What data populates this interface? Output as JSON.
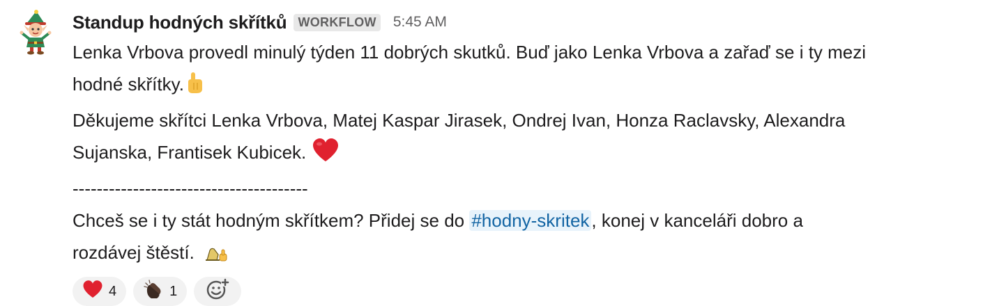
{
  "message": {
    "sender": "Standup hodných skřítků",
    "badge": "WORKFLOW",
    "time": "5:45 AM",
    "line1": "Lenka Vrbova provedl minulý týden 11 dobrých skutků. Buď jako Lenka Vrbova a zařaď se i ty mezi",
    "line2": "hodné skřítky.",
    "line3": "Děkujeme skřítci Lenka Vrbova, Matej Kaspar Jirasek, Ondrej Ivan, Honza Raclavsky, Alexandra",
    "line4": "Sujanska, Frantisek Kubicek.",
    "divider": "---------------------------------------",
    "line5_before": "Chceš se i ty stát hodným skřítkem? Přidej se do ",
    "channel": "#hodny-skritek",
    "line5_after": ", konej v kanceláři dobro a",
    "line6": "rozdávej štěstí."
  },
  "reactions": [
    {
      "icon": "heart-icon",
      "count": "4"
    },
    {
      "icon": "clap-icon",
      "count": "1"
    }
  ],
  "colors": {
    "link": "#1264a3",
    "link_bg": "#e8f3fb",
    "badge_bg": "#e8e8e8",
    "reaction_bg": "#f2f2f2",
    "heart": "#e0212f"
  }
}
